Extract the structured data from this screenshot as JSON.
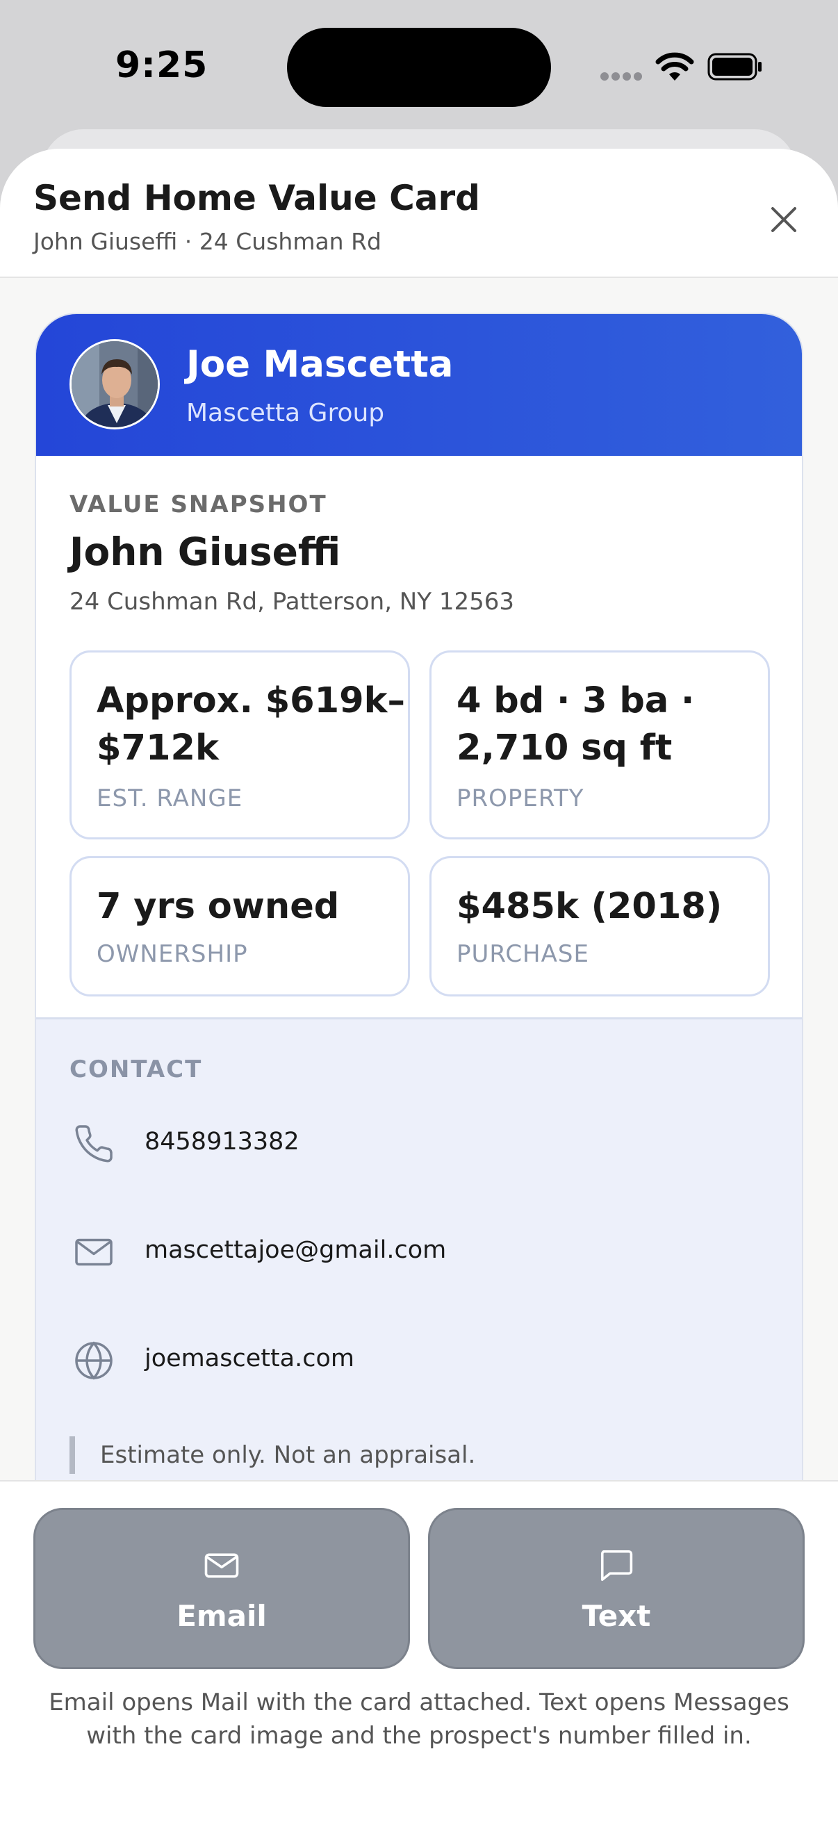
{
  "status_bar": {
    "time": "9:25"
  },
  "sheet": {
    "title": "Send Home Value Card",
    "subtitle": "John Giuseffi · 24 Cushman Rd"
  },
  "agent": {
    "name": "Joe Mascetta",
    "company": "Mascetta Group"
  },
  "snapshot": {
    "label": "VALUE SNAPSHOT",
    "owner_name": "John Giuseffi",
    "address": "24 Cushman Rd, Patterson, NY 12563",
    "stats": [
      {
        "value_line1": "Approx. $619k–",
        "value_line2": "$712k",
        "label": "EST. RANGE"
      },
      {
        "value_line1": "4 bd · 3 ba ·",
        "value_line2": "2,710 sq ft",
        "label": "PROPERTY"
      },
      {
        "value_line1": "7 yrs owned",
        "label": "OWNERSHIP"
      },
      {
        "value_line1": "$485k (2018)",
        "label": "PURCHASE"
      }
    ]
  },
  "contact": {
    "label": "CONTACT",
    "phone": "8458913382",
    "email": "mascettajoe@gmail.com",
    "website": "joemascetta.com",
    "disclaimer": "Estimate only. Not an appraisal."
  },
  "actions": {
    "email_label": "Email",
    "text_label": "Text",
    "hint": "Email opens Mail with the card attached. Text opens Messages with the card image and the prospect's number filled in."
  },
  "colors": {
    "banner": "#2446d8",
    "action_button": "#8f959f",
    "contact_bg": "#edf0fa"
  },
  "icons": [
    "cellular-icon",
    "wifi-icon",
    "battery-icon",
    "close-icon",
    "phone-icon",
    "mail-icon",
    "globe-icon",
    "message-icon"
  ]
}
